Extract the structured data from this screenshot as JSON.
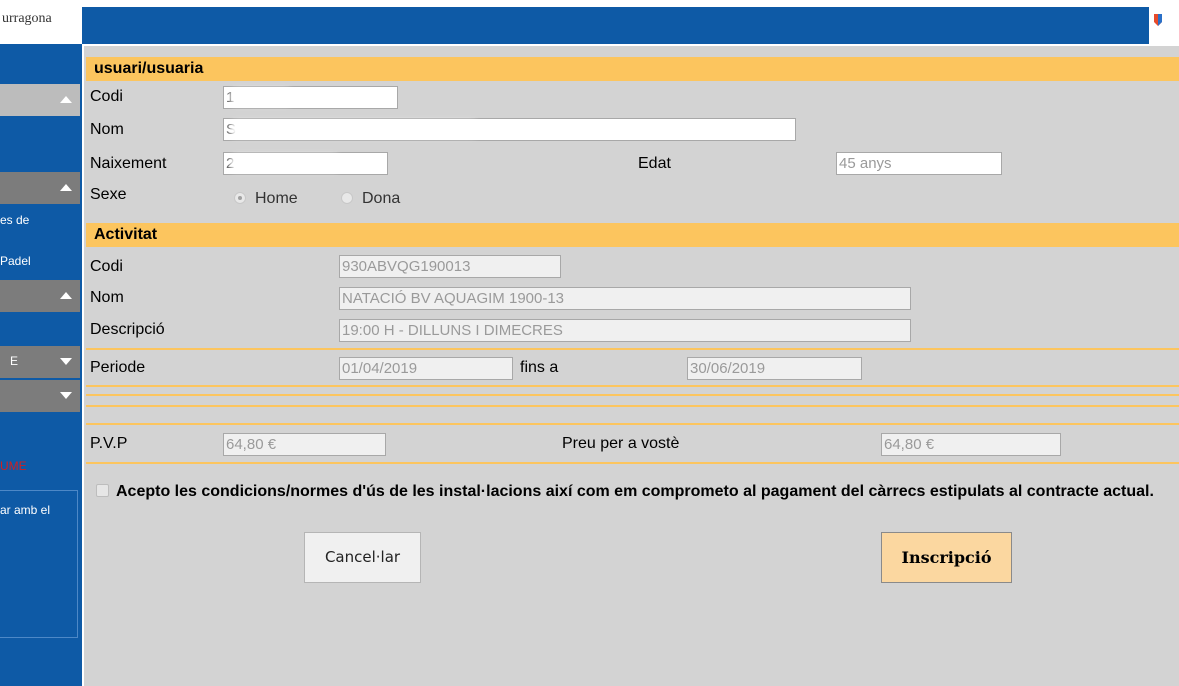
{
  "header": {
    "logo_text": "urragona"
  },
  "sidebar": {
    "items": [
      {
        "label": "es de"
      },
      {
        "label": "Padel"
      },
      {
        "label": "E"
      },
      {
        "label": "UME"
      },
      {
        "label": "ar amb el"
      }
    ]
  },
  "user_section": {
    "title": "usuari/usuaria",
    "codi_label": "Codi",
    "codi_value": "1",
    "nom_label": "Nom",
    "nom_value": "S",
    "naixement_label": "Naixement",
    "naixement_value": "2",
    "edat_label": "Edat",
    "edat_value": "45 anys",
    "sexe_label": "Sexe",
    "sexe_options": [
      "Home",
      "Dona"
    ],
    "sexe_selected": "Home"
  },
  "activity_section": {
    "title": "Activitat",
    "codi_label": "Codi",
    "codi_value": "930ABVQG190013",
    "nom_label": "Nom",
    "nom_value": "NATACIÓ BV AQUAGIM 1900-13",
    "descripcio_label": "Descripció",
    "descripcio_value": "19:00 H - DILLUNS I DIMECRES",
    "periode_label": "Periode",
    "periode_from": "01/04/2019",
    "fins_a_label": "fins a",
    "periode_to": "30/06/2019"
  },
  "pricing": {
    "pvp_label": "P.V.P",
    "pvp_value": "64,80 €",
    "preu_label": "Preu per a vostè",
    "preu_value": "64,80 €"
  },
  "terms": {
    "text": "Acepto les condicions/normes d'ús de les instal·lacions així com em comprometo al pagament del càrrecs estipulats al contracte actual.",
    "checked": false
  },
  "actions": {
    "cancel_label": "Cancel·lar",
    "submit_label": "Inscripció"
  },
  "colors": {
    "brand_blue": "#0e5aa6",
    "section_orange": "#fcc55e",
    "submit_button": "#fbd7a0"
  }
}
